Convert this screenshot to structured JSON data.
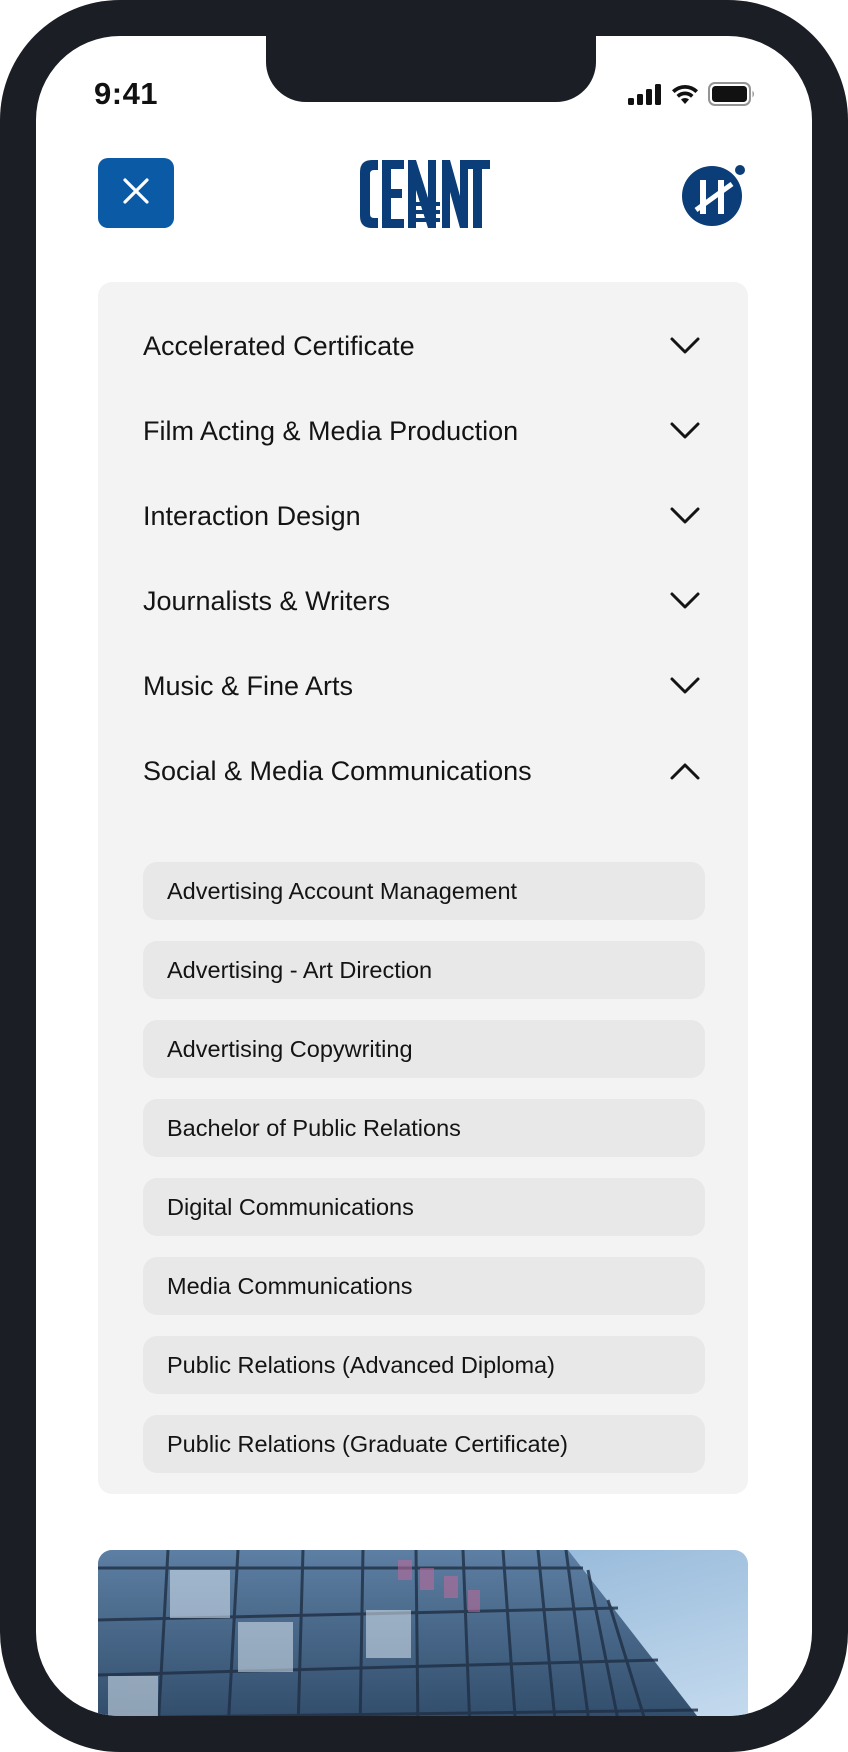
{
  "status_bar": {
    "time": "9:41",
    "signal_icon": "cellular-signal-icon",
    "wifi_icon": "wifi-icon",
    "battery_icon": "battery-icon"
  },
  "header": {
    "close_icon": "close-icon",
    "logo_text": "CENTENNIAL",
    "logo_color": "#0b3d78",
    "profile_icon": "profile-logo-icon",
    "accent_color": "#0b5aa5"
  },
  "menu": {
    "categories": [
      {
        "label": "Accelerated Certificate",
        "expanded": false,
        "icon": "chevron-down-icon"
      },
      {
        "label": "Film Acting & Media Production",
        "expanded": false,
        "icon": "chevron-down-icon"
      },
      {
        "label": "Interaction Design",
        "expanded": false,
        "icon": "chevron-down-icon"
      },
      {
        "label": "Journalists & Writers",
        "expanded": false,
        "icon": "chevron-down-icon"
      },
      {
        "label": "Music & Fine Arts",
        "expanded": false,
        "icon": "chevron-down-icon"
      },
      {
        "label": "Social & Media Communications",
        "expanded": true,
        "icon": "chevron-up-icon"
      }
    ],
    "subitems": [
      {
        "label": "Advertising Account Management"
      },
      {
        "label": "Advertising - Art Direction"
      },
      {
        "label": "Advertising Copywriting"
      },
      {
        "label": "Bachelor of Public Relations"
      },
      {
        "label": "Digital Communications"
      },
      {
        "label": "Media Communications"
      },
      {
        "label": "Public Relations (Advanced Diploma)"
      },
      {
        "label": "Public Relations (Graduate Certificate)"
      }
    ]
  },
  "banner": {
    "image": "campus-building-photo"
  }
}
